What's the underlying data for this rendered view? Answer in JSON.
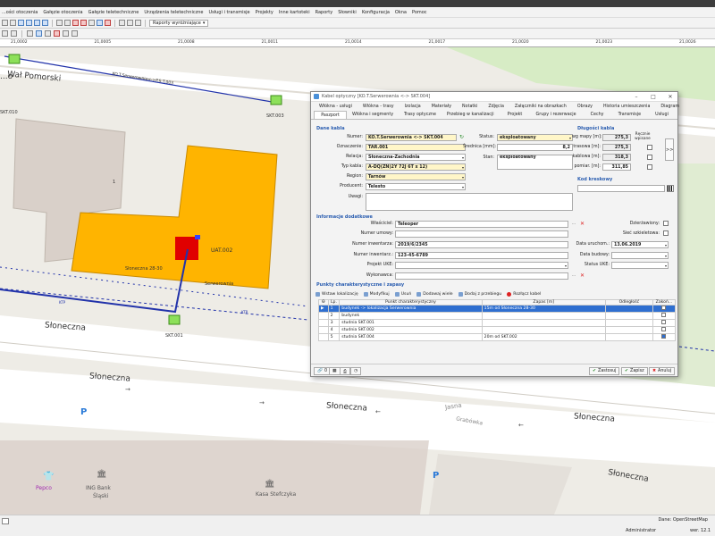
{
  "menu": [
    "...ości otoczenia",
    "Gałęzie otoczenia",
    "Gałęzie teletechniczne",
    "Urządzenia teletechniczne",
    "Usługi i transmisje",
    "Projekty",
    "Inne kartoteki",
    "Raporty",
    "Słowniki",
    "Konfiguracja",
    "Okna",
    "Pomoc"
  ],
  "toolbar": {
    "report_label": "Raporty wyróżniające"
  },
  "ruler": [
    "21,0002",
    "21,0005",
    "21,0008",
    "21,0011",
    "21,0014",
    "21,0017",
    "21,0020",
    "21,0023",
    "21,0026"
  ],
  "map": {
    "labels": {
      "street_top": "Wał Pomorski",
      "street_pre": "...o",
      "cable_label": "KO.T.Serwerownia<->P.S.T.003",
      "skt010": "SKT.010",
      "skt003": "SKT.003",
      "skt001": "SKT.001",
      "uat002": "UAT.002",
      "bldg_num": "1",
      "addr": "Słoneczna 28-30",
      "serwerownia": "Serwerownia",
      "sloneczna_1": "Słoneczna",
      "sloneczna_2": "Słoneczna",
      "sloneczna_3": "Słoneczna",
      "sloneczna_4": "Słoneczna",
      "jasna": "Jasna",
      "grabowka": "Grabówka",
      "pepco": "Pepco",
      "ing": "ING Bank",
      "ing2": "Śląski",
      "kasa": "Kasa Stefczyka",
      "p1": "P",
      "p2": "P",
      "p3": "P",
      "ktp": "KTP",
      "ktp2": "KTP"
    },
    "colors": {
      "building_gray": "#d9d0c9",
      "building_orange": "#ffb400",
      "cable_blue": "#2233aa",
      "road": "#ffffff",
      "green": "#cde6b8"
    }
  },
  "dialog": {
    "title": "Kabel optyczny [KO.T.Serwerownia <-> SKT.004]",
    "tabs_row1": [
      "Włókna - usługi",
      "Włókna - trasy",
      "Izolacja",
      "Materiały",
      "Notatki",
      "Zdjęcia",
      "Załączniki na obrazkach",
      "Obrazy",
      "Historia umieszczenia",
      "Diagram"
    ],
    "tabs_row2": [
      "Paszport",
      "Włókna i segmenty",
      "Trasy optyczne",
      "Przebieg w kanalizacji",
      "Projekt",
      "Grupy i rezerwacje",
      "Cechy",
      "Transmisje",
      "Usługi"
    ],
    "dane": {
      "section": "Dane kabla",
      "numer_label": "Numer:",
      "numer": "KO.T.Serwerownia <-> SKT.004",
      "oznaczenie_label": "Oznaczenie:",
      "oznaczenie": "TAR.001",
      "relacja_label": "Relacja:",
      "relacja": "Słoneczna-Zachodnia",
      "typ_label": "Typ kabla:",
      "typ": "A-DQ(ZN)2Y 72J 6T x 12)",
      "region_label": "Region:",
      "region": "Tarnów",
      "producent_label": "Producent:",
      "producent": "Telesto",
      "uwagi_label": "Uwagi:",
      "status_label": "Status:",
      "status": "eksploatowany",
      "srednica_label": "Średnica [mm]:",
      "srednica": "8,2",
      "stan_label": "Stan:",
      "stan": "eksploatowany"
    },
    "dlugosci": {
      "section": "Długości kabla",
      "wg_mapy_label": "wg mapy [m]:",
      "wg_mapy": "275,3",
      "trasowa_label": "trasowa [m]:",
      "trasowa": "275,3",
      "kablowa_label": "kablowa [m]:",
      "kablowa": "318,3",
      "pomiar_label": "pomiar. [m]:",
      "pomiar": "311,85",
      "recznie_label": "Ręcznie wpisane"
    },
    "kod": {
      "section": "Kod kreskowy"
    },
    "info": {
      "section": "Informacje dodatkowe",
      "wlasciciel_label": "Właściciel:",
      "wlasciciel": "Teleoper",
      "numer_umowy_label": "Numer umowy:",
      "numer_umowy": "",
      "numer_inwentarza_label": "Numer inwentarza:",
      "numer_inwentarza": "2019/6/2345",
      "numer_inwent_label": "Numer inwentarz.:",
      "numer_inwent": "123-45-6789",
      "projekt_label": "Projekt UKE:",
      "projekt": "",
      "wykonawca_label": "Wykonawca:",
      "wykonawca": "",
      "dzierzawiony_label": "Dzierżawiony:",
      "siec_label": "Sieć szkieletowa:",
      "data_uruch_label": "Data uruchom.:",
      "data_uruch": "13.06.2019",
      "data_budowy_label": "Data budowy:",
      "data_budowy": "",
      "status_uke_label": "Status UKE:",
      "status_uke": ""
    },
    "punkty": {
      "section": "Punkty charakterystyczne i zapasy",
      "toolbar": [
        "Wstaw lokalizację",
        "Modyfikuj",
        "Usuń",
        "Dodawaj wiele",
        "Dodaj z przebiegu",
        "Rozłącz kabel"
      ],
      "columns": [
        "Lp.",
        "Punkt charakterystyczny",
        "Zapas [m]",
        "Odległość",
        "Zakoń..."
      ],
      "rows": [
        {
          "lp": "1",
          "punkt": "budynek -> lokalizacja Serwerownia",
          "zapas": "15m od Słoneczna 28-30",
          "odl": "",
          "zak": false
        },
        {
          "lp": "2",
          "punkt": "budynek",
          "zapas": "",
          "odl": "",
          "zak": false
        },
        {
          "lp": "3",
          "punkt": "studnia SKT.001",
          "zapas": "",
          "odl": "",
          "zak": false
        },
        {
          "lp": "4",
          "punkt": "studnia SKT.002",
          "zapas": "",
          "odl": "",
          "zak": false
        },
        {
          "lp": "5",
          "punkt": "studnia SKT.004",
          "zapas": "20m od SKT.002",
          "odl": "",
          "zak": true
        }
      ]
    },
    "footer": {
      "counter": "0",
      "zastosuj": "Zastosuj",
      "zapisz": "Zapisz",
      "anuluj": "Anuluj"
    }
  },
  "status": {
    "dane": "Dane: OpenStreetMap",
    "user": "Administrator",
    "ver": "wer. 12.1"
  }
}
